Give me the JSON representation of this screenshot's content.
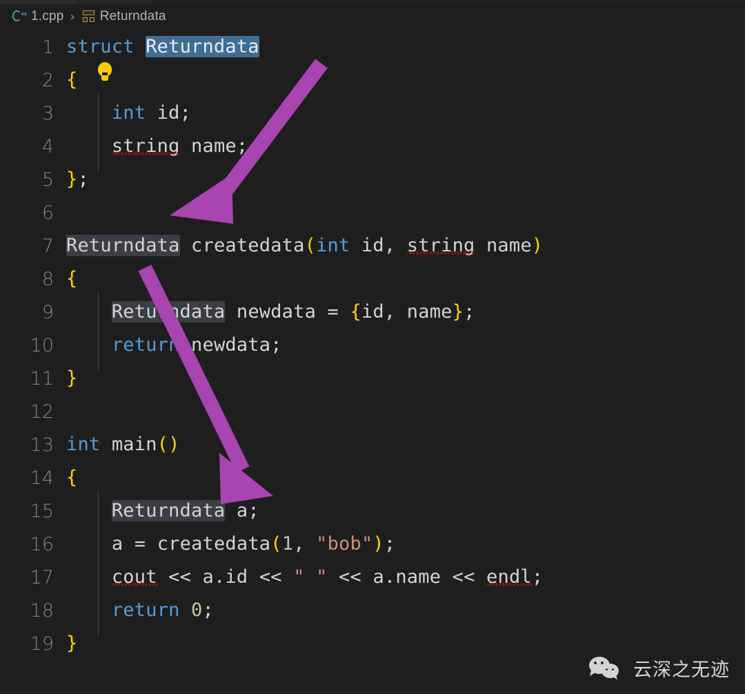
{
  "window": {
    "background": "#1e1e1e",
    "tab_bar_background": "#252526"
  },
  "breadcrumb": {
    "file_icon": "cpp-file-icon",
    "file_name": "1.cpp",
    "separator": "›",
    "symbol_icon": "struct-symbol-icon",
    "symbol_name": "Returndata"
  },
  "editor": {
    "language": "cpp",
    "selection_color": "#3f6d94",
    "occurrence_highlight_color": "#3a3f45",
    "line_number_color": "#858585",
    "lines": [
      {
        "n": "1",
        "text": "struct Returndata"
      },
      {
        "n": "2",
        "text": "{"
      },
      {
        "n": "3",
        "text": "    int id;"
      },
      {
        "n": "4",
        "text": "    string name;"
      },
      {
        "n": "5",
        "text": "};"
      },
      {
        "n": "6",
        "text": ""
      },
      {
        "n": "7",
        "text": "Returndata createdata(int id, string name)"
      },
      {
        "n": "8",
        "text": "{"
      },
      {
        "n": "9",
        "text": "    Returndata newdata = {id, name};"
      },
      {
        "n": "10",
        "text": "    return newdata;"
      },
      {
        "n": "11",
        "text": "}"
      },
      {
        "n": "12",
        "text": ""
      },
      {
        "n": "13",
        "text": "int main()"
      },
      {
        "n": "14",
        "text": "{"
      },
      {
        "n": "15",
        "text": "    Returndata a;"
      },
      {
        "n": "16",
        "text": "    a = createdata(1, \"bob\");"
      },
      {
        "n": "17",
        "text": "    cout << a.id << \" \" << a.name << endl;"
      },
      {
        "n": "18",
        "text": "    return 0;"
      },
      {
        "n": "19",
        "text": "}"
      }
    ],
    "tokens": {
      "struct": "struct",
      "int": "int",
      "string": "string",
      "return": "return",
      "returndata": "Returndata",
      "createdata": "createdata",
      "newdata": "newdata",
      "id": "id",
      "name": "name",
      "main": "main",
      "a": "a",
      "cout": "cout",
      "endl": "endl",
      "number_1": "1",
      "number_0": "0",
      "string_bob": "\"bob\"",
      "string_space": "\" \"",
      "shift_op": "<<",
      "assign_op": "=",
      "semicolon": ";",
      "comma": ",",
      "paren_open": "(",
      "paren_close": ")",
      "brace_open": "{",
      "brace_close": "}",
      "dot_id": "a.id",
      "dot_name": "a.name"
    },
    "colors": {
      "keyword": "#569cd6",
      "identifier": "#d4d4d4",
      "number": "#b5cea8",
      "string": "#ce9178",
      "bracket_yellow": "#ffd700",
      "error_squiggle": "#e51400"
    },
    "quick_fix_icon": "lightbulb-icon",
    "quick_fix_line": "2"
  },
  "annotations": {
    "arrow_color": "#a845b0",
    "arrows": [
      {
        "label": "arrow-struct-to-returntype",
        "from": "line1-Returndata",
        "to": "line7-Returndata"
      },
      {
        "label": "arrow-returntype-to-variable",
        "from": "line7-Returndata",
        "to": "line15-Returndata"
      }
    ]
  },
  "watermark": {
    "icon": "wechat-icon",
    "text": "云深之无迹"
  }
}
